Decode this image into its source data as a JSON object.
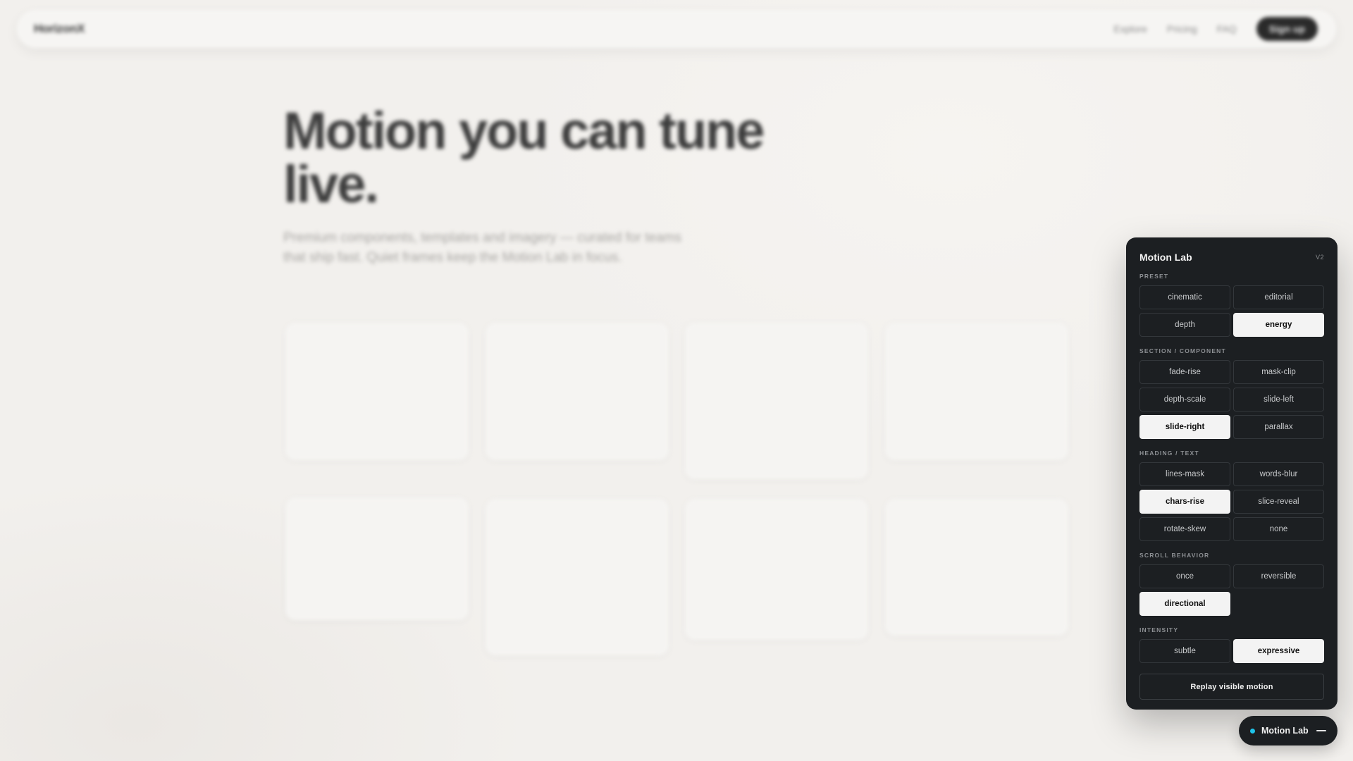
{
  "nav": {
    "logo": "HorizonX",
    "links": [
      "Explore",
      "Pricing",
      "FAQ"
    ],
    "signup": "Sign up"
  },
  "hero": {
    "title": "Motion you can tune live.",
    "subtitle": "Premium components, templates and imagery — curated for teams that ship fast. Quiet frames keep the Motion Lab in focus."
  },
  "panel": {
    "title": "Motion Lab",
    "version": "V2",
    "sections": {
      "preset": {
        "label": "PRESET",
        "options": [
          "cinematic",
          "editorial",
          "depth",
          "energy"
        ],
        "selected": "energy"
      },
      "component": {
        "label": "SECTION / COMPONENT",
        "options": [
          "fade-rise",
          "mask-clip",
          "depth-scale",
          "slide-left",
          "slide-right",
          "parallax"
        ],
        "selected": "slide-right"
      },
      "heading": {
        "label": "HEADING / TEXT",
        "options": [
          "lines-mask",
          "words-blur",
          "chars-rise",
          "slice-reveal",
          "rotate-skew",
          "none"
        ],
        "selected": "chars-rise"
      },
      "scroll": {
        "label": "SCROLL BEHAVIOR",
        "options": [
          "once",
          "reversible",
          "directional"
        ],
        "selected": "directional"
      },
      "intensity": {
        "label": "INTENSITY",
        "options": [
          "subtle",
          "expressive"
        ],
        "selected": "expressive"
      }
    },
    "replay": "Replay visible motion"
  },
  "toggle": {
    "label": "Motion Lab",
    "status_color": "#1fc4ea",
    "icon": "minimize-icon"
  }
}
